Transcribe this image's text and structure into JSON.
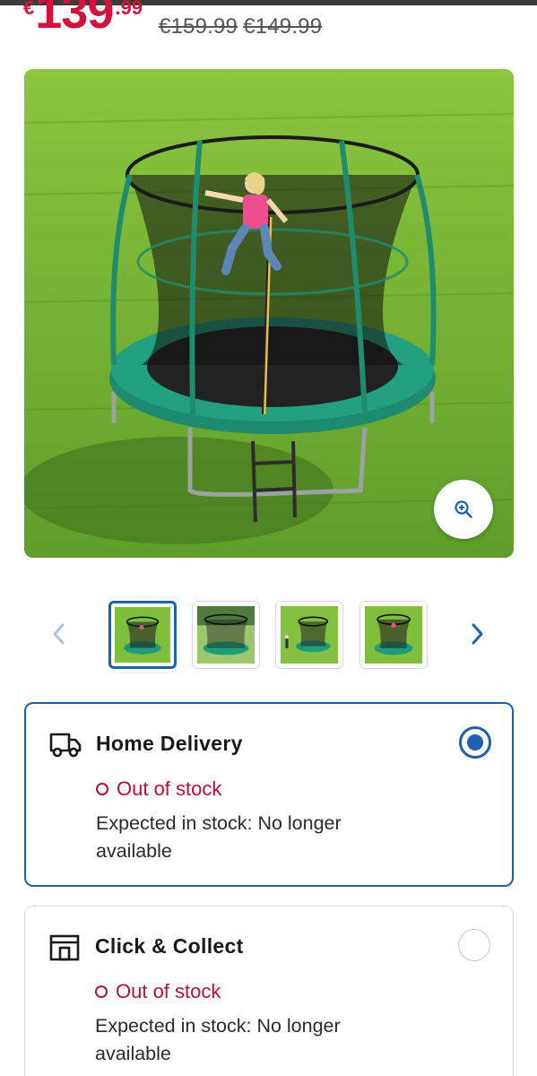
{
  "price": {
    "currency": "€",
    "whole": "139",
    "cents": ".99",
    "was_1": "€159.99",
    "was_2": "€149.99"
  },
  "product_image": {
    "alt": "trampoline with safety net"
  },
  "gallery": {
    "prev_icon": "chevron-left-icon",
    "next_icon": "chevron-right-icon",
    "zoom_icon": "zoom-in-icon",
    "thumbnail_count": 4,
    "active_index": 0
  },
  "delivery_options": [
    {
      "title": "Home Delivery",
      "icon": "truck-icon",
      "status": "Out of stock",
      "expected": "Expected in stock: No longer available",
      "selected": true
    },
    {
      "title": "Click & Collect",
      "icon": "store-icon",
      "status": "Out of stock",
      "expected": "Expected in stock: No longer available",
      "selected": false
    }
  ],
  "colors": {
    "price": "#d4123c",
    "out_of_stock": "#b5122f",
    "accent": "#1f5fae"
  }
}
